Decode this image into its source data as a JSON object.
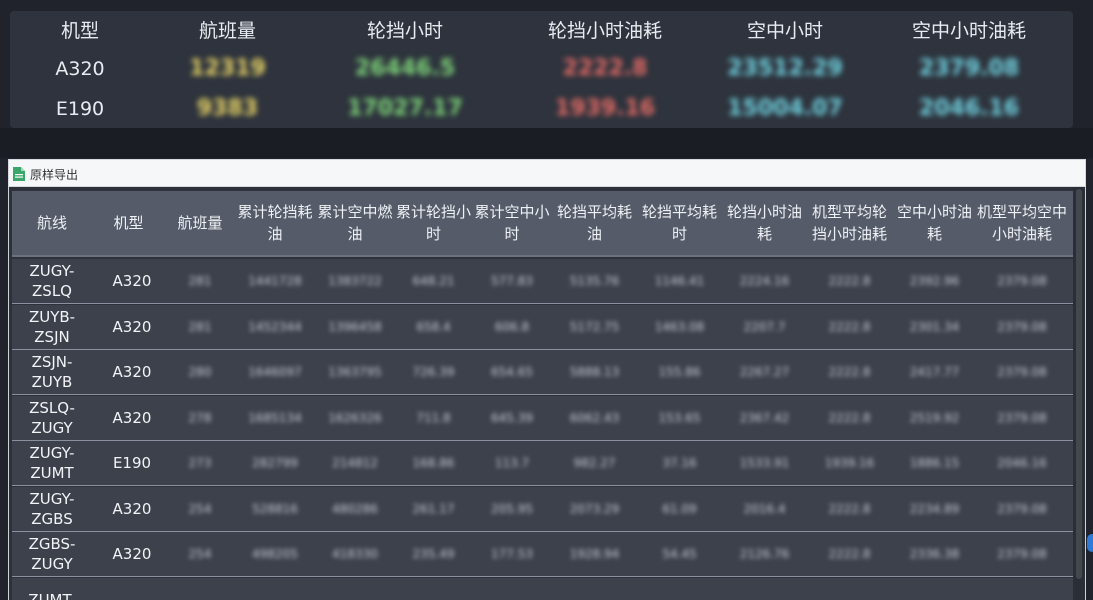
{
  "summary": {
    "headers": [
      "机型",
      "航班量",
      "轮挡小时",
      "轮挡小时油耗",
      "空中小时",
      "空中小时油耗"
    ],
    "rows": [
      {
        "model": "A320",
        "values": [
          "12319",
          "26446.5",
          "2222.8",
          "23512.29",
          "2379.08"
        ]
      },
      {
        "model": "E190",
        "values": [
          "9383",
          "17027.17",
          "1939.16",
          "15004.07",
          "2046.16"
        ]
      }
    ],
    "colors": {
      "flights": "#e8d466",
      "block_hours": "#7fd77a",
      "block_fuel": "#e36b64",
      "air_hours": "#6fd3e0",
      "air_fuel": "#6fd3e0"
    }
  },
  "toolbar": {
    "export_label": "原样导出",
    "export_icon": "excel-sheet-icon"
  },
  "table": {
    "headers": [
      "航线",
      "机型",
      "航班量",
      "累计轮挡耗油",
      "累计空中燃油",
      "累计轮挡小时",
      "累计空中小时",
      "轮挡平均耗油",
      "轮挡平均耗时",
      "轮挡小时油耗",
      "机型平均轮挡小时油耗",
      "空中小时油耗",
      "机型平均空中小时油耗"
    ],
    "rows": [
      {
        "route": "ZUGY-ZSLQ",
        "model": "A320",
        "cells": [
          "281",
          "1441728",
          "1383722",
          "648.21",
          "577.83",
          "5135.76",
          "1146.41",
          "2224.16",
          "2222.8",
          "2392.96",
          "2379.08"
        ]
      },
      {
        "route": "ZUYB-ZSJN",
        "model": "A320",
        "cells": [
          "281",
          "1452344",
          "1396458",
          "658.4",
          "606.8",
          "5172.75",
          "1463.08",
          "2207.7",
          "2222.8",
          "2301.34",
          "2379.08"
        ]
      },
      {
        "route": "ZSJN-ZUYB",
        "model": "A320",
        "cells": [
          "280",
          "1646097",
          "1363795",
          "726.39",
          "654.65",
          "5888.13",
          "155.86",
          "2267.27",
          "2222.8",
          "2417.77",
          "2379.08"
        ]
      },
      {
        "route": "ZSLQ-ZUGY",
        "model": "A320",
        "cells": [
          "278",
          "1685134",
          "1626326",
          "711.8",
          "645.39",
          "6062.43",
          "153.65",
          "2367.42",
          "2222.8",
          "2519.92",
          "2379.08"
        ]
      },
      {
        "route": "ZUGY-ZUMT",
        "model": "E190",
        "cells": [
          "273",
          "282799",
          "214812",
          "168.86",
          "113.7",
          "982.27",
          "37.16",
          "1533.91",
          "1939.16",
          "1886.15",
          "2046.16"
        ]
      },
      {
        "route": "ZUGY-ZGBS",
        "model": "A320",
        "cells": [
          "254",
          "528816",
          "480286",
          "261.17",
          "205.95",
          "2073.29",
          "61.09",
          "2016.4",
          "2222.8",
          "2234.89",
          "2379.08"
        ]
      },
      {
        "route": "ZGBS-ZUGY",
        "model": "A320",
        "cells": [
          "254",
          "498205",
          "418330",
          "235.49",
          "177.53",
          "1928.94",
          "54.45",
          "2126.76",
          "2222.8",
          "2336.38",
          "2379.08"
        ]
      },
      {
        "route": "ZUMT-",
        "model": "",
        "cells": [
          "",
          "",
          "",
          "",
          "",
          "",
          "",
          "",
          "",
          "",
          ""
        ]
      }
    ]
  }
}
